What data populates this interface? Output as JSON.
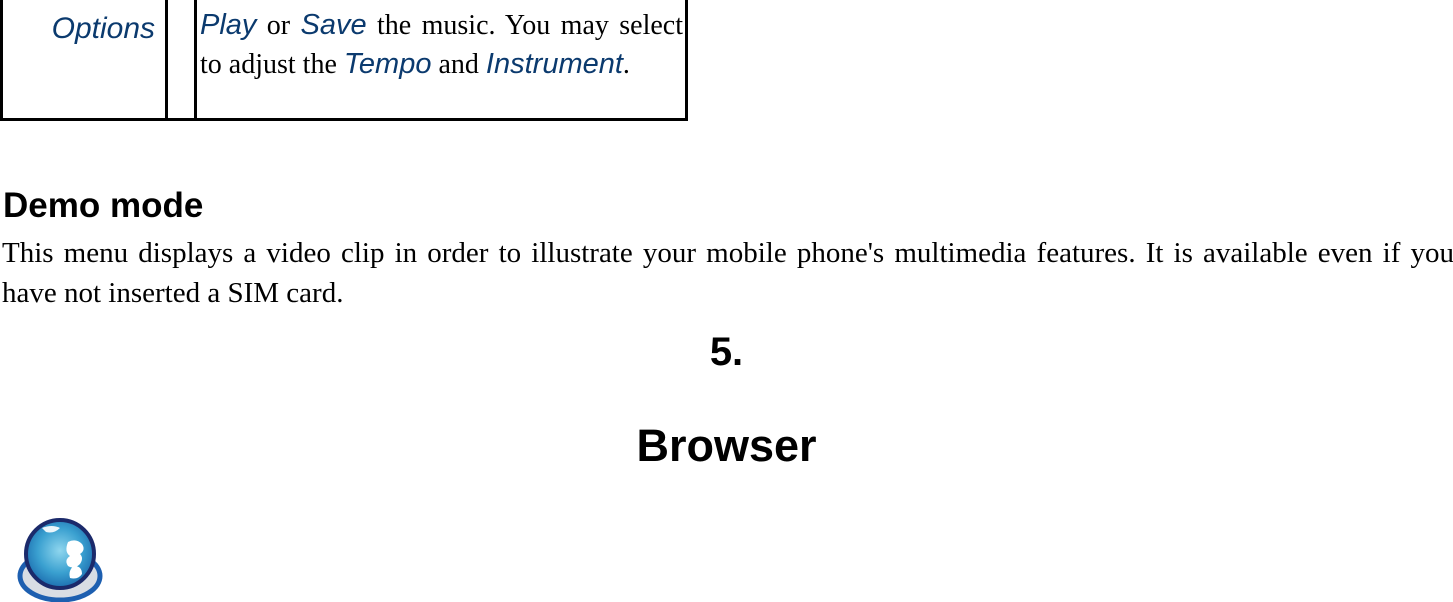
{
  "options_table": {
    "label": "Options",
    "description": {
      "kw_play": "Play",
      "t1": " or ",
      "kw_save": "Save",
      "t2": " the music. You may select to adjust the ",
      "kw_tempo": "Tempo",
      "t3": " and ",
      "kw_instrument": "Instrument",
      "t4": "."
    }
  },
  "demo_mode": {
    "heading": "Demo mode",
    "body": "This menu displays a video clip in order to illustrate your mobile phone's multimedia features. It is available even if you have not inserted a SIM card."
  },
  "chapter": {
    "number": "5.",
    "title": "Browser",
    "icon": "globe-icon"
  },
  "colors": {
    "keyword": "#0b3a6e",
    "text": "#000000"
  }
}
